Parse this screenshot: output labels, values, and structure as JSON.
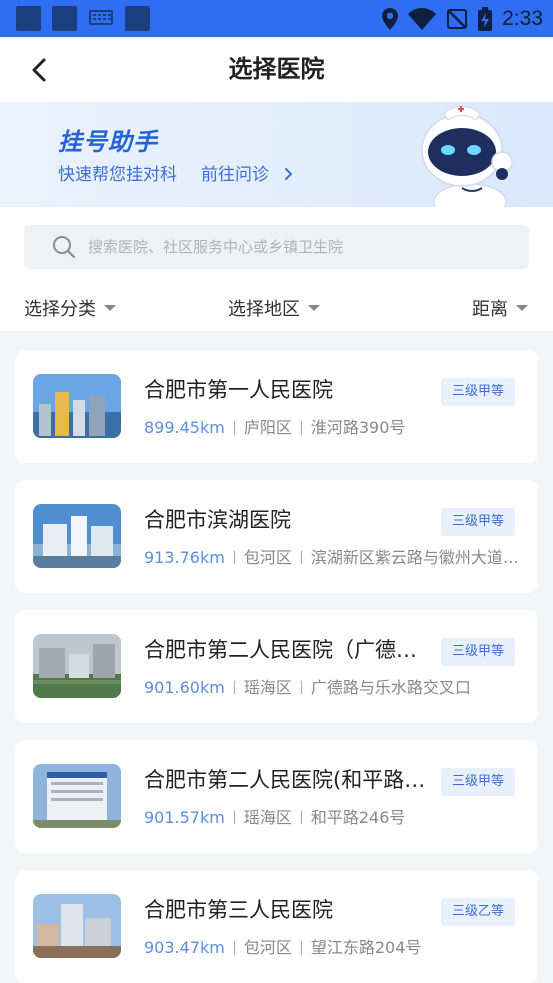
{
  "status_bar": {
    "time": "2:33",
    "color": "#2f6df2",
    "icons": [
      "location-icon",
      "wifi-icon",
      "no-signal-icon",
      "battery-charging-icon"
    ]
  },
  "nav": {
    "title": "选择医院",
    "back_icon": "chevron-left-icon"
  },
  "banner": {
    "title": "挂号助手",
    "subtitle": "快速帮您挂对科",
    "link": "前往问诊",
    "link_icon": "chevron-right-icon",
    "mascot": "robot-nurse-icon"
  },
  "search": {
    "placeholder": "搜索医院、社区服务中心或乡镇卫生院",
    "value": ""
  },
  "filters": {
    "category": "选择分类",
    "region": "选择地区",
    "sort": "距离"
  },
  "hospitals": [
    {
      "name": "合肥市第一人民医院",
      "distance": "899.45km",
      "district": "庐阳区",
      "address": "淮河路390号",
      "level": "三级甲等"
    },
    {
      "name": "合肥市滨湖医院",
      "distance": "913.76km",
      "district": "包河区",
      "address": "滨湖新区紫云路与徽州大道交口",
      "level": "三级甲等"
    },
    {
      "name": "合肥市第二人民医院（广德路院区）",
      "distance": "901.60km",
      "district": "瑶海区",
      "address": "广德路与乐水路交叉口",
      "level": "三级甲等"
    },
    {
      "name": "合肥市第二人民医院(和平路院区)",
      "distance": "901.57km",
      "district": "瑶海区",
      "address": "和平路246号",
      "level": "三级甲等"
    },
    {
      "name": "合肥市第三人民医院",
      "distance": "903.47km",
      "district": "包河区",
      "address": "望江东路204号",
      "level": "三级乙等"
    }
  ],
  "colors": {
    "accent": "#2f6df2",
    "distance": "#5b8fe0",
    "badge_bg": "#e8f0fc",
    "badge_text": "#3d6fd1",
    "page_bg": "#f4f5f7"
  }
}
